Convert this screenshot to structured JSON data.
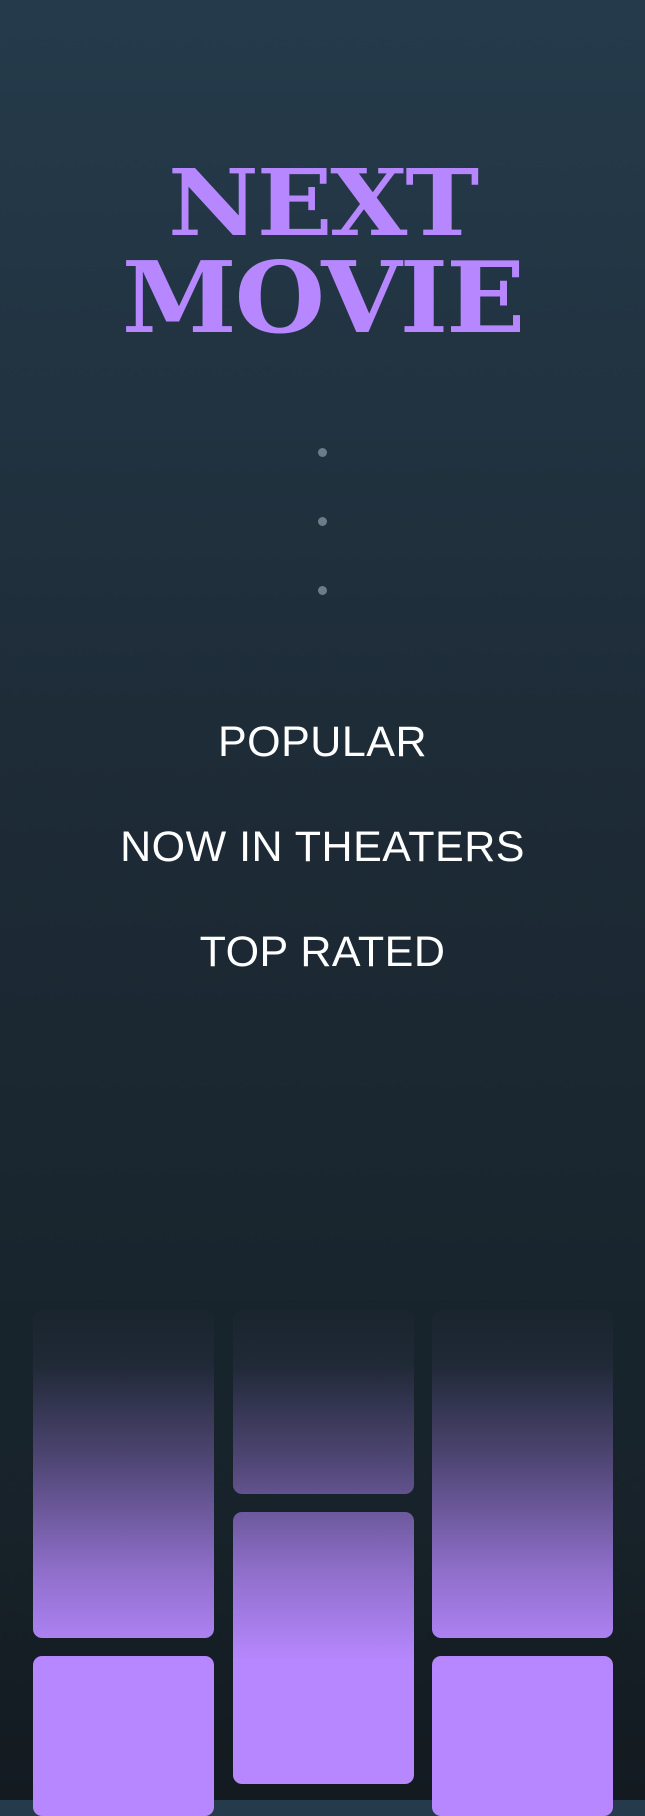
{
  "app": {
    "logo_line1": "NEXT",
    "logo_line2": "MOVIE"
  },
  "loader": {
    "dot_count": 3
  },
  "menu": {
    "items": [
      {
        "label": "POPULAR"
      },
      {
        "label": "NOW IN THEATERS"
      },
      {
        "label": "TOP RATED"
      }
    ]
  },
  "colors": {
    "accent": "#b687fe",
    "background_top": "#253b4b",
    "background_bottom": "#131b21",
    "text": "#ffffff",
    "dot": "#6c7d89"
  }
}
